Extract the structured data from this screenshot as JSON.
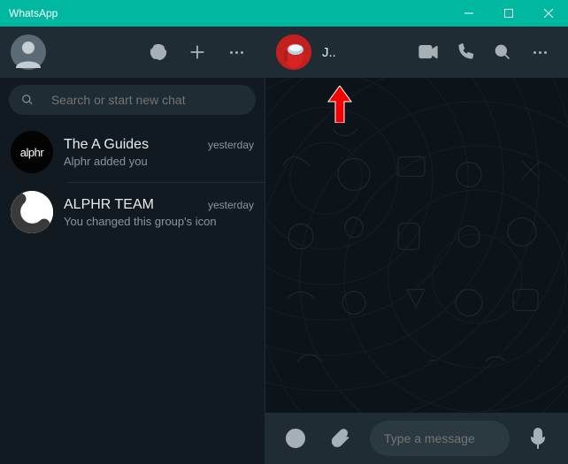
{
  "window": {
    "title": "WhatsApp"
  },
  "left": {
    "search_placeholder": "Search or start new chat",
    "chats": [
      {
        "name": "The A Guides",
        "time": "yesterday",
        "msg": "Alphr added you",
        "avatar_text": "alphr"
      },
      {
        "name": "ALPHR TEAM",
        "time": "yesterday",
        "msg": "You changed this group's icon",
        "avatar_text": ""
      }
    ]
  },
  "right": {
    "contact_name": "J..",
    "message_placeholder": "Type a message"
  }
}
